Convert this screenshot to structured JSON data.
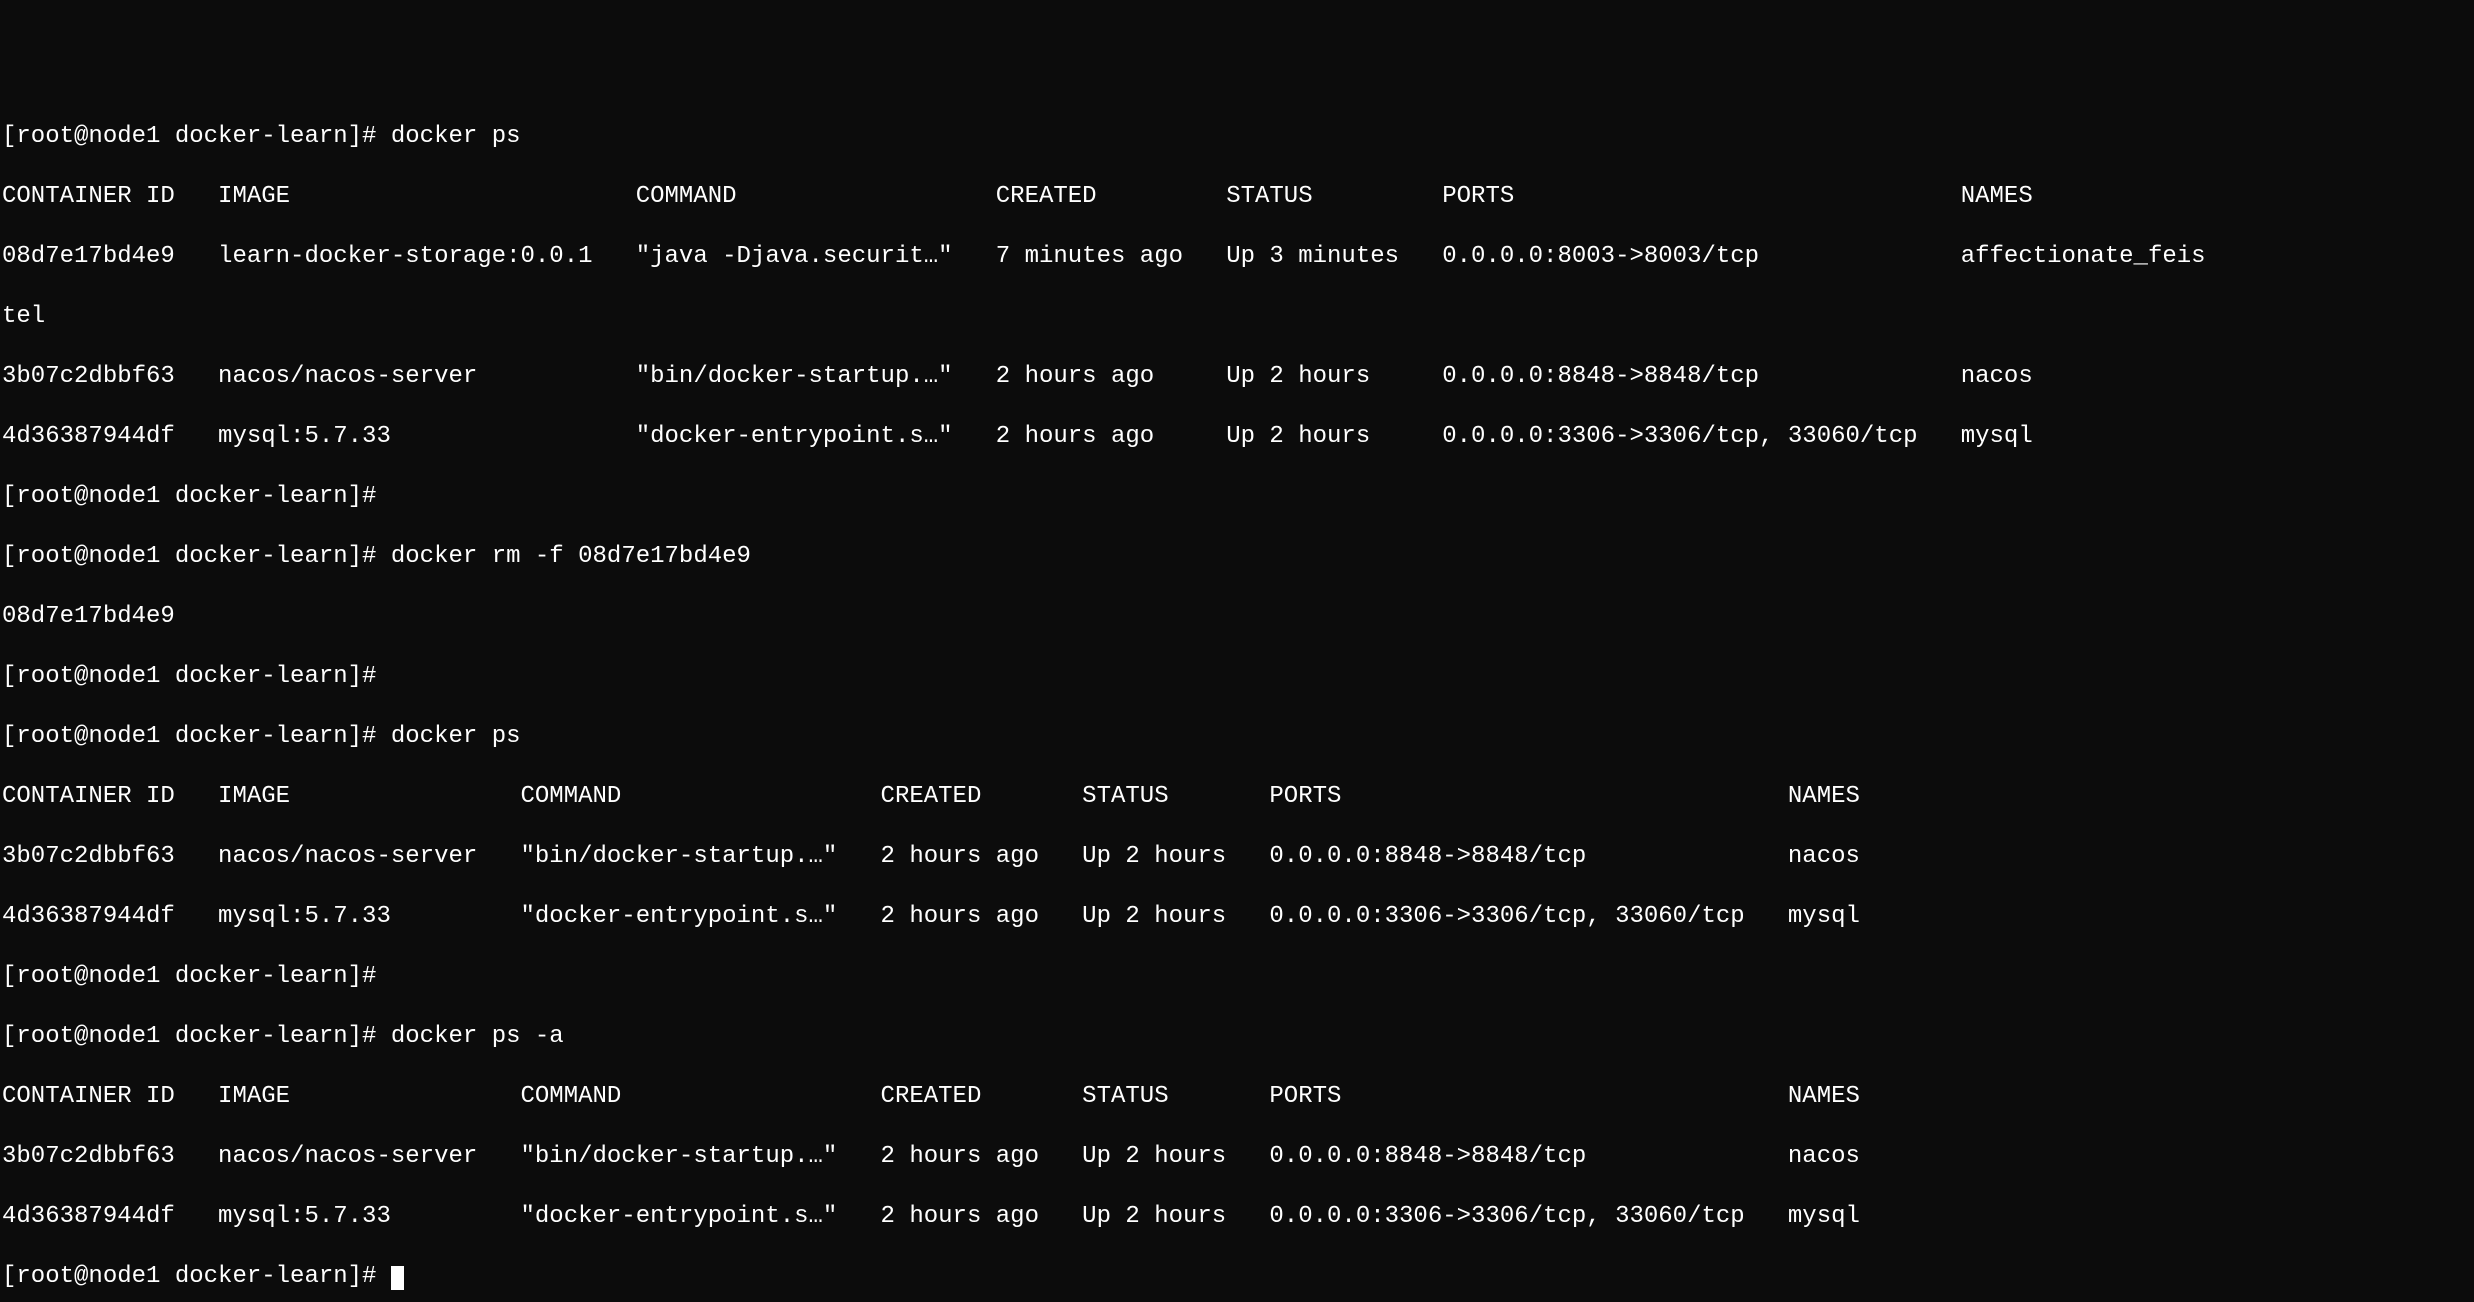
{
  "prompt": "[root@node1 docker-learn]#",
  "commands": {
    "cmd1": "docker ps",
    "cmd2": "docker rm -f 08d7e17bd4e9",
    "cmd3": "docker ps",
    "cmd4": "docker ps -a"
  },
  "rm_output": "08d7e17bd4e9",
  "table1": {
    "header": "CONTAINER ID   IMAGE                        COMMAND                  CREATED         STATUS         PORTS                               NAMES",
    "row1": "08d7e17bd4e9   learn-docker-storage:0.0.1   \"java -Djava.securit…\"   7 minutes ago   Up 3 minutes   0.0.0.0:8003->8003/tcp              affectionate_feis",
    "row1b": "tel",
    "row2": "3b07c2dbbf63   nacos/nacos-server           \"bin/docker-startup.…\"   2 hours ago     Up 2 hours     0.0.0.0:8848->8848/tcp              nacos",
    "row3": "4d36387944df   mysql:5.7.33                 \"docker-entrypoint.s…\"   2 hours ago     Up 2 hours     0.0.0.0:3306->3306/tcp, 33060/tcp   mysql"
  },
  "table2": {
    "header": "CONTAINER ID   IMAGE                COMMAND                  CREATED       STATUS       PORTS                               NAMES",
    "row1": "3b07c2dbbf63   nacos/nacos-server   \"bin/docker-startup.…\"   2 hours ago   Up 2 hours   0.0.0.0:8848->8848/tcp              nacos",
    "row2": "4d36387944df   mysql:5.7.33         \"docker-entrypoint.s…\"   2 hours ago   Up 2 hours   0.0.0.0:3306->3306/tcp, 33060/tcp   mysql"
  },
  "table3": {
    "header": "CONTAINER ID   IMAGE                COMMAND                  CREATED       STATUS       PORTS                               NAMES",
    "row1": "3b07c2dbbf63   nacos/nacos-server   \"bin/docker-startup.…\"   2 hours ago   Up 2 hours   0.0.0.0:8848->8848/tcp              nacos",
    "row2": "4d36387944df   mysql:5.7.33         \"docker-entrypoint.s…\"   2 hours ago   Up 2 hours   0.0.0.0:3306->3306/tcp, 33060/tcp   mysql"
  }
}
